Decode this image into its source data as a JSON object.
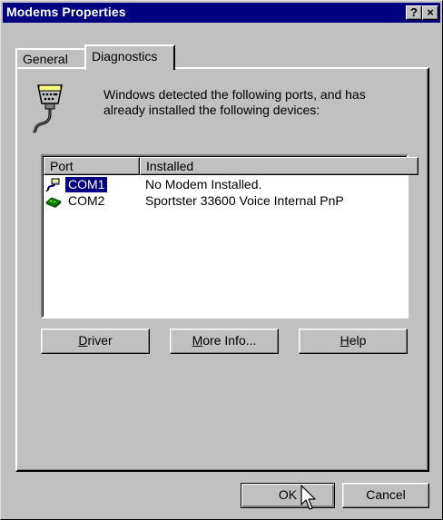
{
  "window": {
    "title": "Modems Properties",
    "help_glyph": "?",
    "close_glyph": "×"
  },
  "tabs": [
    {
      "label": "General",
      "active": false
    },
    {
      "label": "Diagnostics",
      "active": true
    }
  ],
  "diagnostics": {
    "description": "Windows detected the following ports, and has already installed the following devices:",
    "icon": "serial-port-cable-icon",
    "columns": [
      "Port",
      "Installed"
    ],
    "rows": [
      {
        "port": "COM1",
        "installed": "No Modem Installed.",
        "icon": "port-cable-icon",
        "selected": true
      },
      {
        "port": "COM2",
        "installed": "Sportster 33600 Voice Internal PnP",
        "icon": "modem-icon",
        "selected": false
      }
    ],
    "buttons": {
      "driver_mnemonic": "D",
      "driver_rest": "river",
      "moreinfo_mnemonic": "M",
      "moreinfo_rest": "ore Info...",
      "help_mnemonic": "H",
      "help_rest": "elp"
    }
  },
  "footer": {
    "ok_label": "OK",
    "cancel_label": "Cancel"
  },
  "colors": {
    "title_bar": "#000080",
    "face": "#c0c0c0",
    "selection": "#000080",
    "modem_green": "#009000"
  }
}
